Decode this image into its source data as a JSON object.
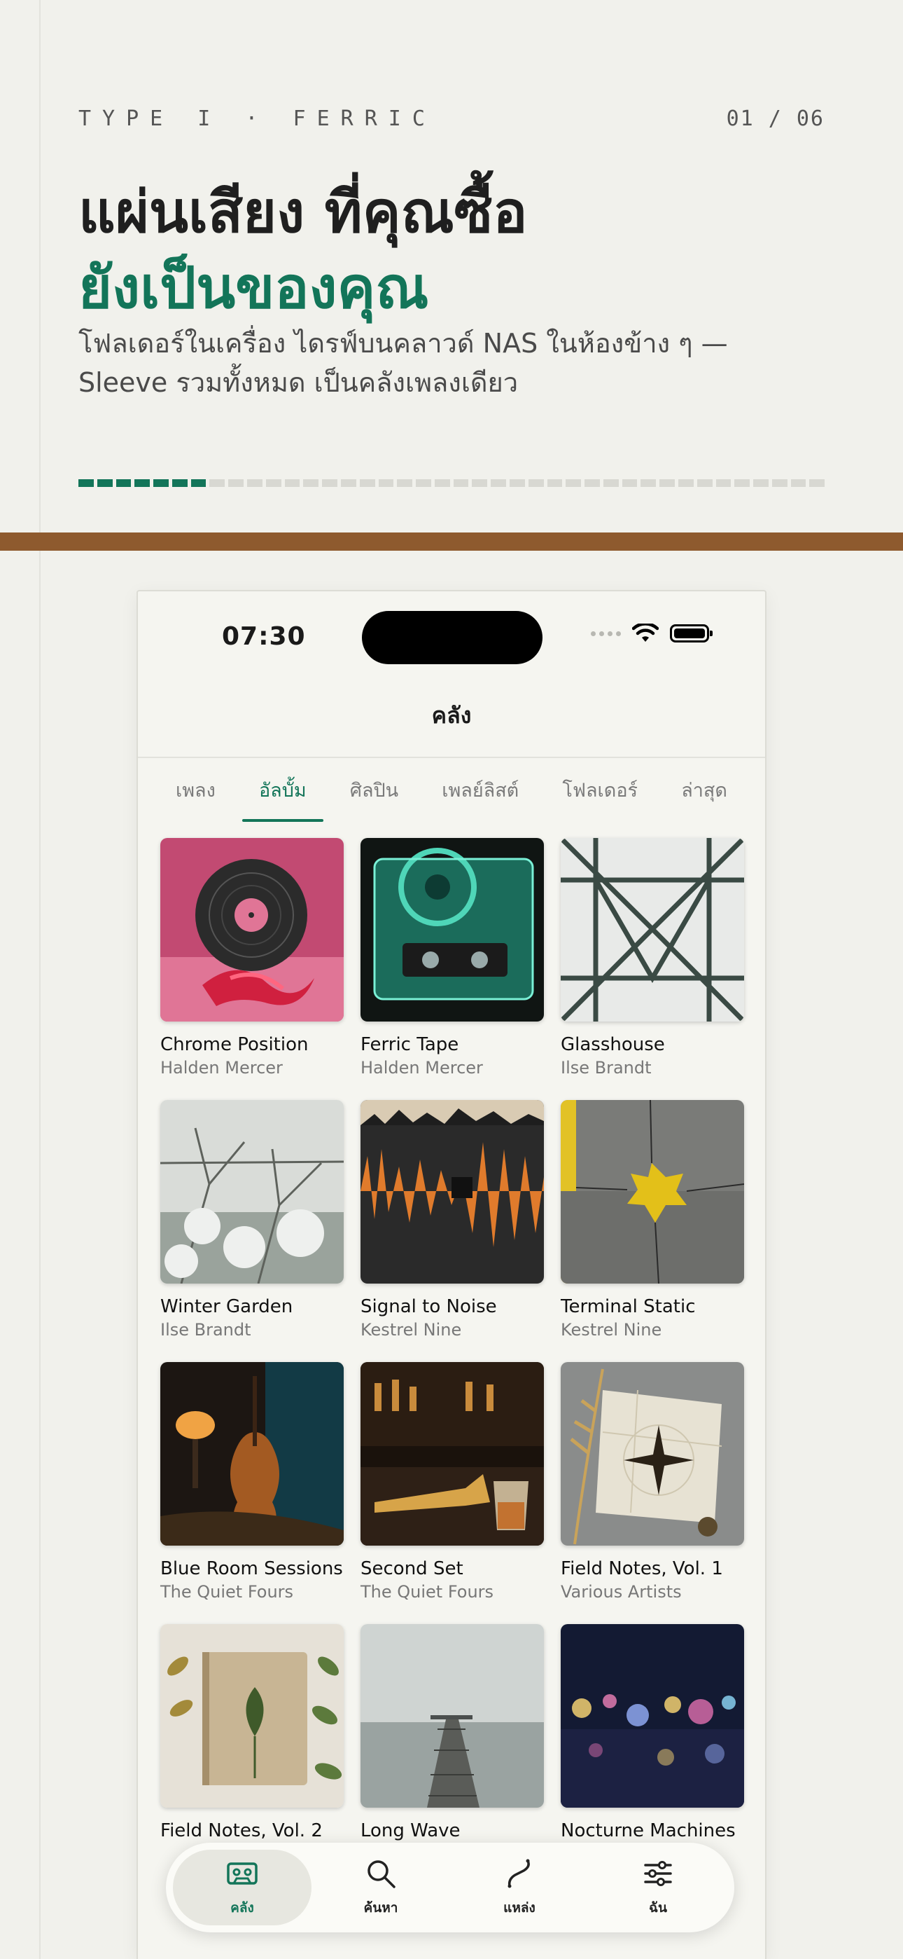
{
  "hero": {
    "eyebrow": "TYPE I · FERRIC",
    "page_counter": "01 / 06",
    "headline_line1": "แผ่นเสียง ที่คุณซื้อ",
    "headline_line2": "ยังเป็นของคุณ",
    "subtext": "โฟลเดอร์ในเครื่อง ไดรฟ์บนคลาวด์ NAS ในห้องข้าง ๆ — Sleeve รวมทั้งหมด เป็นคลังเพลงเดียว",
    "progress_segments_total": 40,
    "progress_segments_filled": 7,
    "accent_color": "#137559",
    "band_color": "#8e5a2e"
  },
  "status_bar": {
    "time": "07:30"
  },
  "nav": {
    "title": "คลัง"
  },
  "tabs": [
    {
      "label": "เพลง"
    },
    {
      "label": "อัลบั้ม"
    },
    {
      "label": "ศิลปิน"
    },
    {
      "label": "เพลย์ลิสต์"
    },
    {
      "label": "โฟลเดอร์"
    },
    {
      "label": "ล่าสุด"
    }
  ],
  "active_tab": "อัลบั้ม",
  "albums": [
    {
      "title": "Chrome Position",
      "artist": "Halden Mercer",
      "cover": "vinyl-record-pink"
    },
    {
      "title": "Ferric Tape",
      "artist": "Halden Mercer",
      "cover": "cassette-tape-teal"
    },
    {
      "title": "Glasshouse",
      "artist": "Ilse Brandt",
      "cover": "glass-roof-lattice"
    },
    {
      "title": "Winter Garden",
      "artist": "Ilse Brandt",
      "cover": "frosted-branches"
    },
    {
      "title": "Signal to Noise",
      "artist": "Kestrel Nine",
      "cover": "orange-waveform"
    },
    {
      "title": "Terminal Static",
      "artist": "Kestrel Nine",
      "cover": "yellow-crack-wall"
    },
    {
      "title": "Blue Room Sessions",
      "artist": "The Quiet Fours",
      "cover": "cello-blue-room"
    },
    {
      "title": "Second Set",
      "artist": "The Quiet Fours",
      "cover": "bar-trumpet-glass"
    },
    {
      "title": "Field Notes, Vol. 1",
      "artist": "Various Artists",
      "cover": "compass-map-paper"
    },
    {
      "title": "Field Notes, Vol. 2",
      "artist": "",
      "cover": "notebook-leaves"
    },
    {
      "title": "Long Wave",
      "artist": "",
      "cover": "foggy-pier"
    },
    {
      "title": "Nocturne Machines",
      "artist": "",
      "cover": "city-bokeh-rain"
    }
  ],
  "tabbar": [
    {
      "label": "คลัง",
      "icon": "cassette-icon",
      "active": true
    },
    {
      "label": "ค้นหา",
      "icon": "search-icon",
      "active": false
    },
    {
      "label": "แหล่ง",
      "icon": "source-link-icon",
      "active": false
    },
    {
      "label": "ฉัน",
      "icon": "sliders-icon",
      "active": false
    }
  ]
}
